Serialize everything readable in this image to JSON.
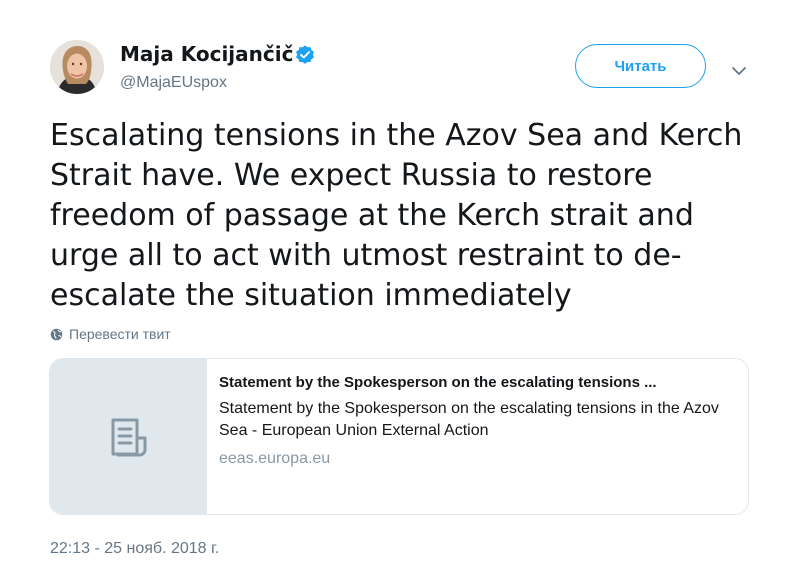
{
  "author": {
    "display_name": "Maja Kocijančič",
    "handle": "@MajaEUspox",
    "verified": true
  },
  "actions": {
    "follow_label": "Читать"
  },
  "tweet": {
    "text": "Escalating tensions in the Azov Sea and Kerch Strait have. We expect Russia to restore freedom of passage at the Kerch strait and urge all to act with utmost restraint to de-escalate the situation immediately",
    "translate_label": "Перевести твит",
    "timestamp": "22:13 - 25 нояб. 2018 г."
  },
  "card": {
    "title": "Statement by the Spokesperson on the escalating tensions ...",
    "description": "Statement by the Spokesperson on the escalating tensions in the Azov Sea - European Union External Action",
    "domain": "eeas.europa.eu",
    "thumbnail_icon": "document-icon"
  },
  "colors": {
    "accent": "#1da1f2",
    "muted": "#657786",
    "card_border": "#e1e8ed"
  }
}
